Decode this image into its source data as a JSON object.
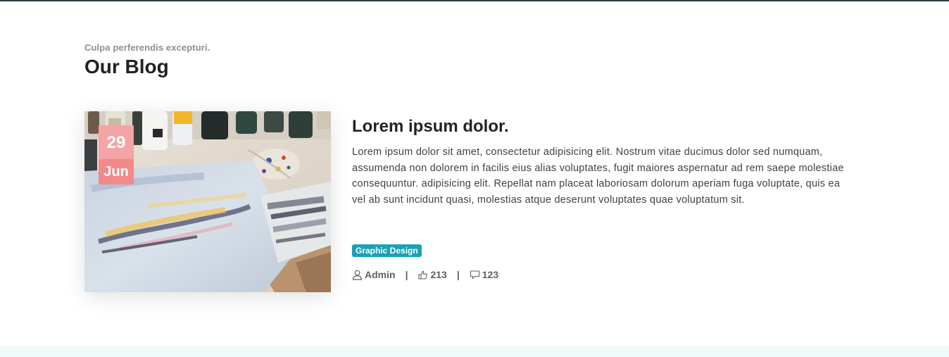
{
  "section": {
    "subtitle": "Culpa perferendis excepturi.",
    "title": "Our Blog"
  },
  "post": {
    "date": {
      "day": "29",
      "month": "Jun"
    },
    "title": "Lorem ipsum dolor.",
    "excerpt": "Lorem ipsum dolor sit amet, consectetur adipisicing elit. Nostrum vitae ducimus dolor sed numquam, assumenda non dolorem in facilis eius alias voluptates, fugit maiores aspernatur ad rem saepe molestiae consequuntur. adipisicing elit. Repellat nam placeat laboriosam dolorum aperiam fuga voluptate, quis ea vel ab sunt incidunt quasi, molestias atque deserunt voluptates quae voluptatum sit.",
    "category_tag": "Graphic Design",
    "meta": {
      "author": "Admin",
      "likes": "213",
      "comments": "123",
      "separator": "|"
    },
    "image_icon": "painting-photo"
  },
  "colors": {
    "date_day_bg": "#f4a4a4",
    "date_month_bg": "#f28a8a",
    "tag_bg": "#17a2b8",
    "bottom_band": "#eef9fa"
  },
  "icons": {
    "author": "user-icon",
    "likes": "thumbs-up-icon",
    "comments": "comment-icon"
  }
}
